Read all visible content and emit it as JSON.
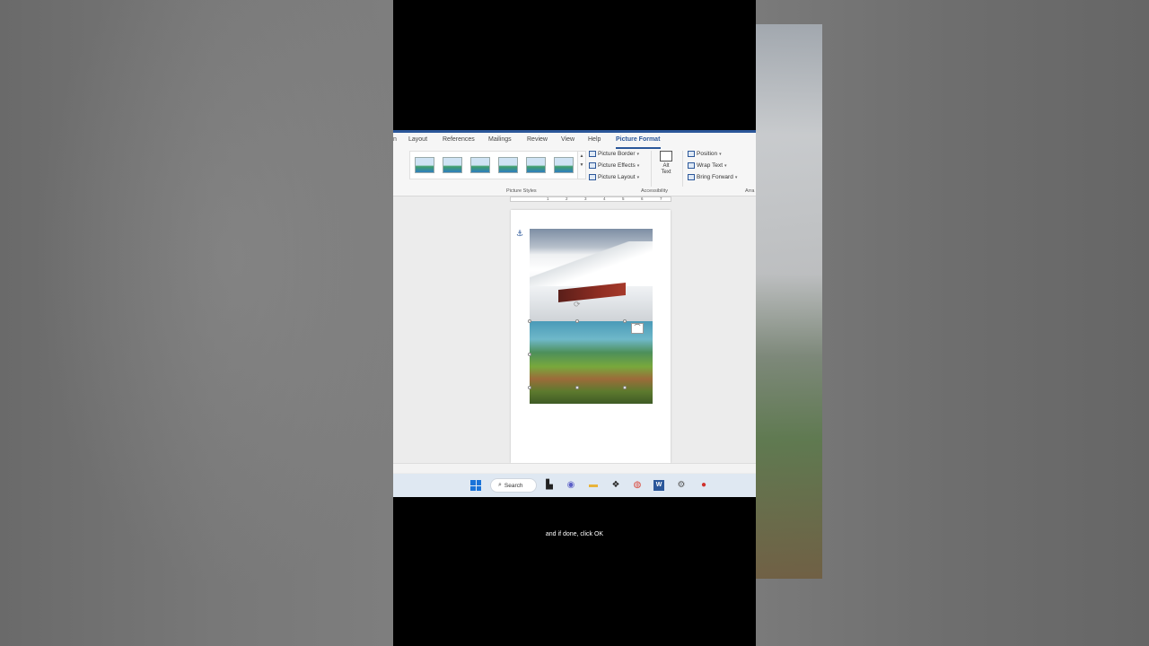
{
  "ribbon": {
    "tabs": [
      {
        "label": "n"
      },
      {
        "label": "Layout"
      },
      {
        "label": "References"
      },
      {
        "label": "Mailings"
      },
      {
        "label": "Review"
      },
      {
        "label": "View"
      },
      {
        "label": "Help"
      },
      {
        "label": "Picture Format"
      }
    ],
    "active_tab": "Picture Format",
    "picture_styles_label": "Picture Styles",
    "picture_border": "Picture Border",
    "picture_effects": "Picture Effects",
    "picture_layout": "Picture Layout",
    "alt_text_line1": "Alt",
    "alt_text_line2": "Text",
    "accessibility_label": "Accessibility",
    "position": "Position",
    "wrap_text": "Wrap Text",
    "bring_forward": "Bring Forward",
    "arrange_label": "Arra"
  },
  "ruler": {
    "numbers": [
      "1",
      "2",
      "3",
      "4",
      "5",
      "6",
      "7"
    ]
  },
  "taskbar": {
    "search_label": "Search",
    "icons": [
      "windows-icon",
      "task-view-icon",
      "teams-icon",
      "file-explorer-icon",
      "dropbox-icon",
      "chrome-icon",
      "word-icon",
      "settings-icon",
      "record-icon"
    ]
  },
  "caption": "and if done, click OK",
  "colors": {
    "accent": "#2b579a",
    "taskbar": "#dfe8f2"
  }
}
